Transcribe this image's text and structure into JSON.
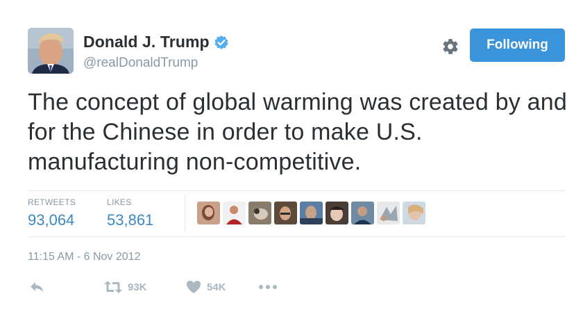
{
  "user": {
    "display_name": "Donald J. Trump",
    "handle": "@realDonaldTrump",
    "verified": true
  },
  "follow_button": {
    "label": "Following",
    "color": "#3b94d9"
  },
  "tweet": {
    "text": "The concept of global warming was created by and for the Chinese in order to make U.S. manufacturing non-competitive.",
    "timestamp": "11:15 AM - 6 Nov 2012"
  },
  "stats": {
    "retweets_label": "RETWEETS",
    "retweets_value": "93,064",
    "likes_label": "LIKES",
    "likes_value": "53,861"
  },
  "actions": {
    "retweet_count": "93K",
    "like_count": "54K"
  },
  "icons": {
    "settings": "gear-icon",
    "verified": "verified-badge-icon",
    "reply": "reply-icon",
    "retweet": "retweet-icon",
    "like": "heart-icon",
    "more": "more-dots-icon"
  },
  "colors": {
    "link_blue": "#3b88c3",
    "muted_gray": "#8899a6",
    "icon_gray": "#aab8c2"
  }
}
